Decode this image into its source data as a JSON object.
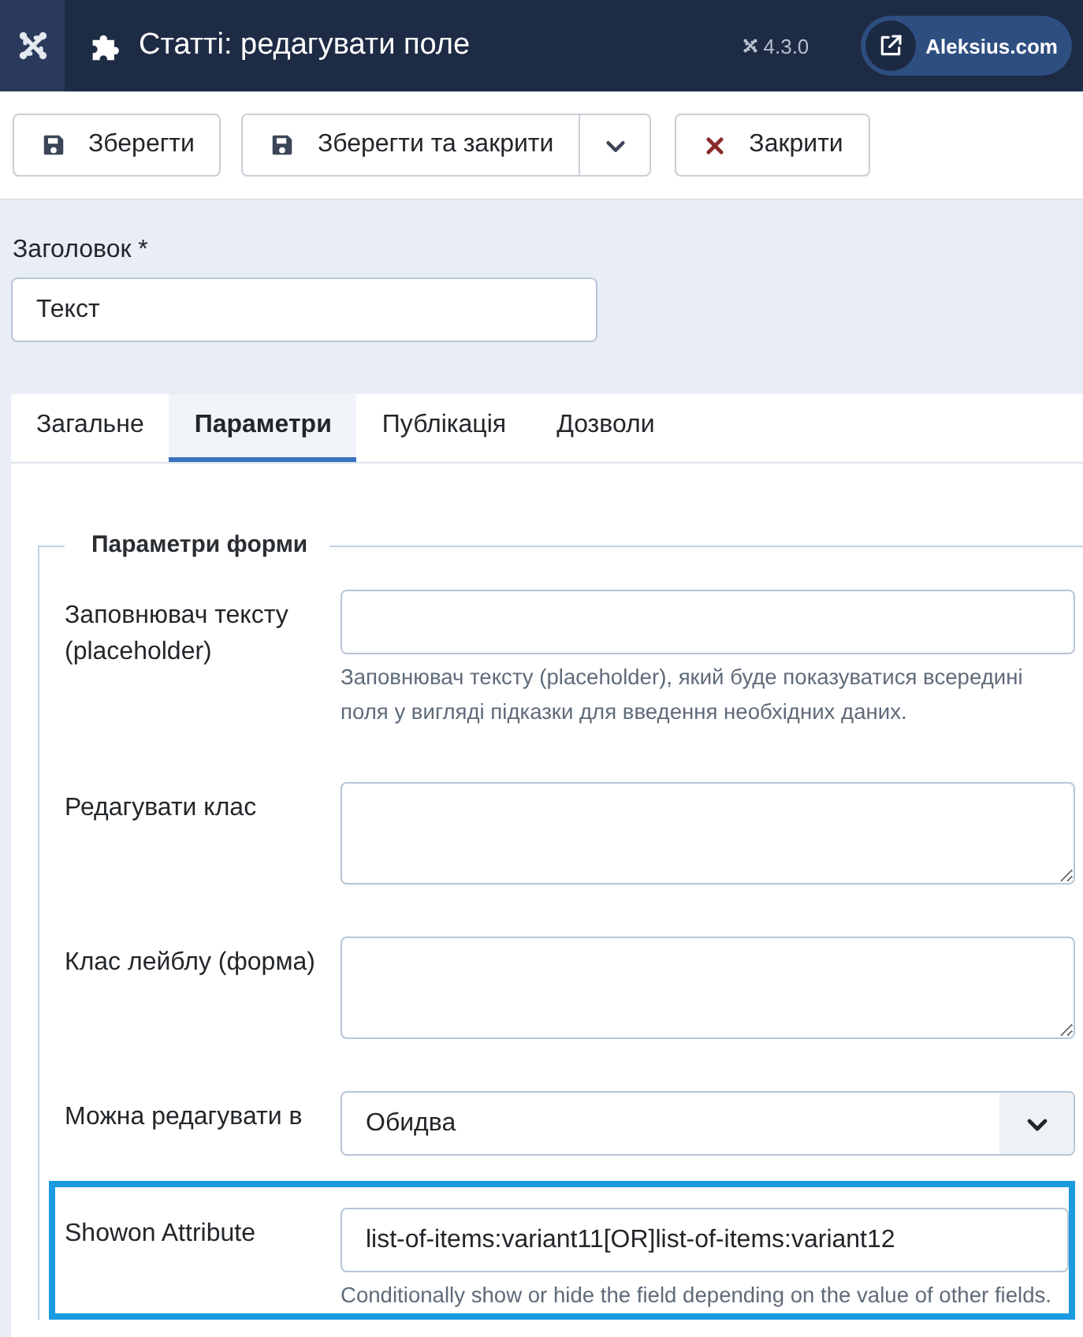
{
  "header": {
    "title": "Статті: редагувати поле",
    "version": "4.3.0",
    "site_link": "Aleksius.com"
  },
  "toolbar": {
    "buttons": [
      {
        "label": "Зберегти",
        "kind": "save"
      },
      {
        "label": "Зберегти та закрити",
        "kind": "save-split"
      },
      {
        "label": "Закрити",
        "kind": "close"
      }
    ]
  },
  "title_field": {
    "label": "Заголовок *",
    "value": "Текст"
  },
  "tabs": [
    {
      "label": "Загальне",
      "selected": false
    },
    {
      "label": "Параметри",
      "selected": true
    },
    {
      "label": "Публікація",
      "selected": false
    },
    {
      "label": "Дозволи",
      "selected": false
    }
  ],
  "fieldset": {
    "legend": "Параметри форми",
    "fields": [
      {
        "kind": "input",
        "label": "Заповнювач тексту (placeholder)",
        "description": "Заповнювач тексту (placeholder), який буде показуватися всередині поля у вигляді підказки для введення необхідних даних.",
        "highlighted": false
      },
      {
        "kind": "textarea",
        "label": "Редагувати клас",
        "highlighted": false
      },
      {
        "kind": "textarea",
        "label": "Клас лейблу (форма)",
        "highlighted": false
      },
      {
        "kind": "select",
        "label": "Можна редагувати в",
        "value": "Обидва",
        "highlighted": false
      },
      {
        "kind": "input",
        "label": "Showon Attribute",
        "value": "list-of-items:variant11[OR]list-of-items:variant12",
        "description": "Conditionally show or hide the field depending on the value of other fields.",
        "highlighted": true
      }
    ]
  }
}
